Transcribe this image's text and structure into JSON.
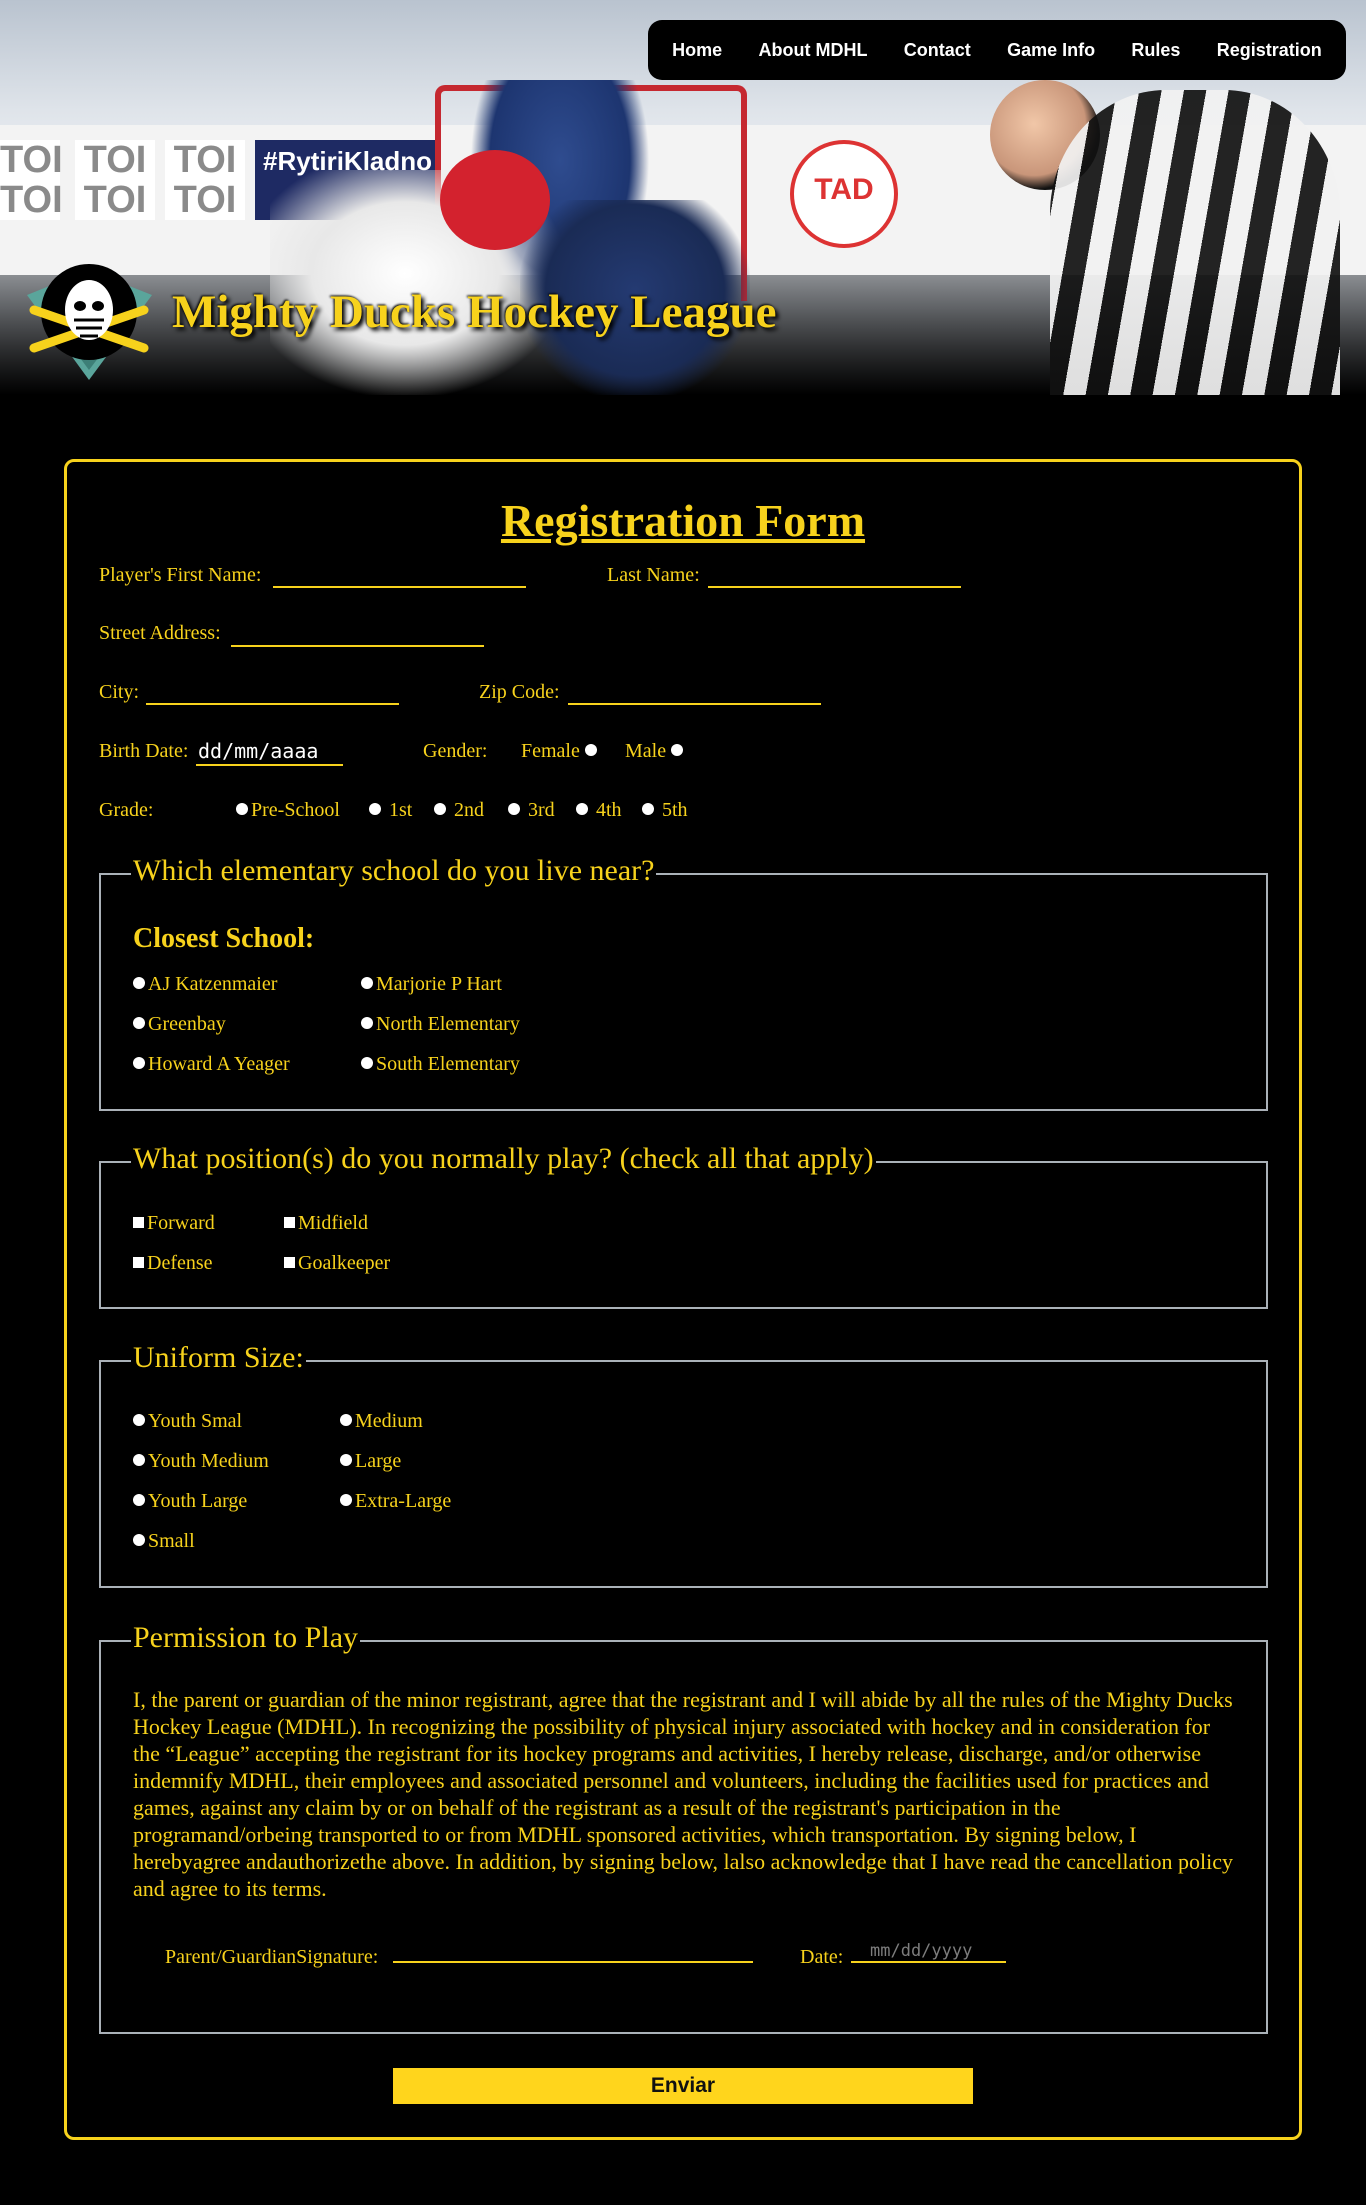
{
  "header": {
    "site_title": "Mighty Ducks Hockey League",
    "ads": [
      "TOI TOI",
      "TOI TOI",
      "TOI TOI"
    ],
    "banner": "#RytiriKladno",
    "tad": "TAD"
  },
  "nav": {
    "items": [
      {
        "label": "Home"
      },
      {
        "label": "About MDHL"
      },
      {
        "label": "Contact"
      },
      {
        "label": "Game Info"
      },
      {
        "label": "Rules"
      },
      {
        "label": "Registration"
      }
    ]
  },
  "form": {
    "title": "Registration Form",
    "first_name_label": "Player's First Name:",
    "last_name_label": "Last Name:",
    "street_label": "Street Address:",
    "city_label": "City:",
    "zip_label": "Zip Code:",
    "birth_label": "Birth Date:",
    "birth_value": "dd/mm/aaaa",
    "gender_label": "Gender:",
    "gender_options": [
      "Female",
      "Male"
    ],
    "grade_label": "Grade:",
    "grade_options": [
      "Pre-School",
      "1st",
      "2nd",
      "3rd",
      "4th",
      "5th"
    ],
    "school": {
      "legend": "Which elementary school do you live near?",
      "heading": "Closest School:",
      "options": [
        "AJ Katzenmaier",
        "Marjorie P Hart",
        "Greenbay",
        "North Elementary",
        "Howard A Yeager",
        "South Elementary"
      ]
    },
    "position": {
      "legend": "What position(s) do you normally play? (check all that apply)",
      "options": [
        "Forward",
        "Midfield",
        "Defense",
        "Goalkeeper"
      ]
    },
    "uniform": {
      "legend": "Uniform Size:",
      "options": [
        "Youth Smal",
        "Medium",
        "Youth Medium",
        "Large",
        "Youth Large",
        "Extra-Large",
        "Small"
      ]
    },
    "permission": {
      "legend": "Permission to Play",
      "text": "I, the parent or guardian of the minor registrant, agree that the registrant and I will abide by all the rules of the Mighty Ducks Hockey League (MDHL). In recognizing the possibility of physical injury associated with hockey and in consideration for the “League” accepting the registrant for its hockey programs and activities, I hereby release, discharge, and/or otherwise indemnify MDHL, their employees and associated personnel and volunteers, including the facilities used for practices and games, against any claim by or on behalf of the registrant as a result of the registrant's participation in the programand/orbeing transported to or from MDHL sponsored activities, which transportation. By signing below, I herebyagree andauthorizethe above. In addition, by signing below, lalso acknowledge that I have read the cancellation policy and agree to its terms.",
      "signature_label": "Parent/GuardianSignature:",
      "date_label": "Date:",
      "date_placeholder": "mm/dd/yyyy"
    },
    "submit_label": "Enviar"
  },
  "colors": {
    "accent": "#f7d21c",
    "background": "#000000",
    "button": "#ffd51c"
  }
}
